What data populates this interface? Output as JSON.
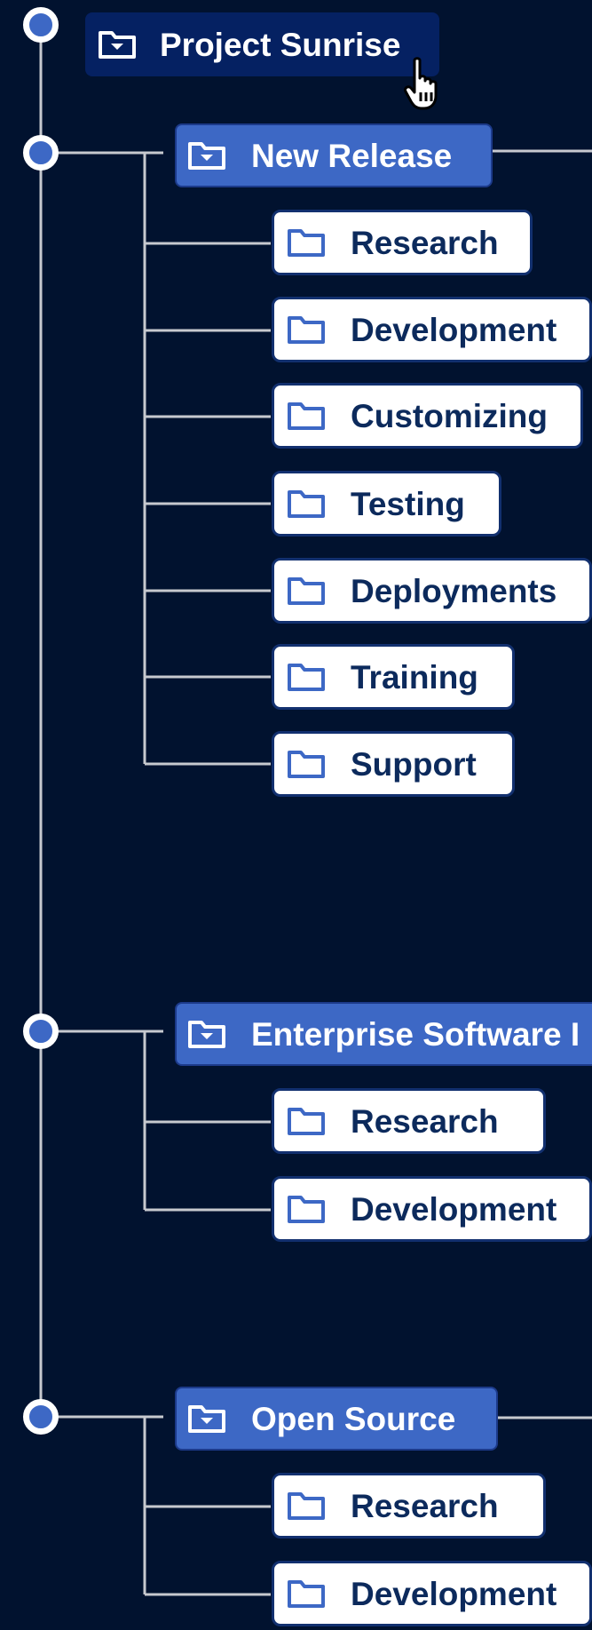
{
  "tree": {
    "root": {
      "label": "Project Sunrise",
      "icon": "folder-open-icon"
    },
    "groups": [
      {
        "label": "New Release",
        "icon": "folder-open-icon",
        "children": [
          "Research",
          "Development",
          "Customizing",
          "Testing",
          "Deployments",
          "Training",
          "Support"
        ]
      },
      {
        "label": "Enterprise Software I",
        "icon": "folder-open-icon",
        "children": [
          "Research",
          "Development"
        ]
      },
      {
        "label": "Open Source",
        "icon": "folder-open-icon",
        "children": [
          "Research",
          "Development"
        ]
      }
    ],
    "leaf_icon": "folder-icon"
  },
  "colors": {
    "background": "#01122f",
    "root_fill": "#052162",
    "group_fill": "#3d68c5",
    "leaf_fill": "#ffffff",
    "leaf_text": "#0c2a5c",
    "connector": "#c7c9cf"
  },
  "cursor": {
    "icon": "hand-pointer-icon"
  }
}
